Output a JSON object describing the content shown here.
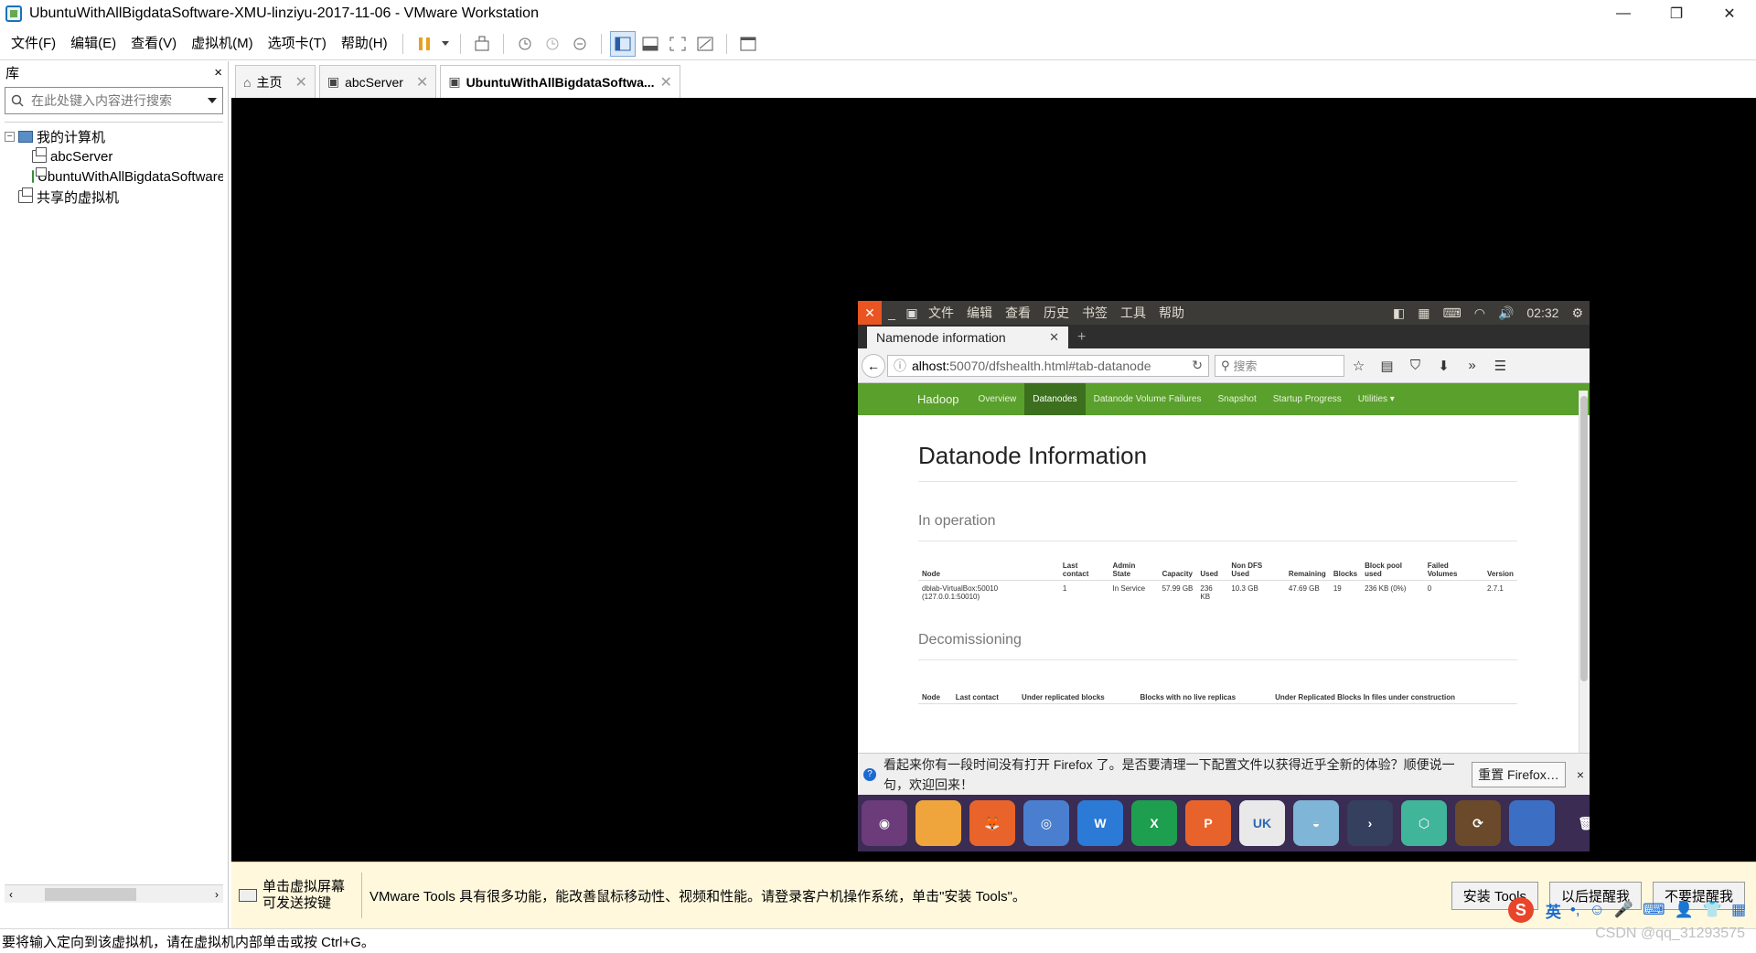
{
  "window": {
    "title": "UbuntuWithAllBigdataSoftware-XMU-linziyu-2017-11-06 - VMware Workstation",
    "minimize": "—",
    "maximize": "❐",
    "close": "✕"
  },
  "menu": [
    "文件(F)",
    "编辑(E)",
    "查看(V)",
    "虚拟机(M)",
    "选项卡(T)",
    "帮助(H)"
  ],
  "library": {
    "title": "库",
    "close": "×",
    "search_placeholder": "在此处键入内容进行搜索",
    "tree": {
      "root": "我的计算机",
      "vms": [
        "abcServer",
        "UbuntuWithAllBigdataSoftware"
      ],
      "shared": "共享的虚拟机"
    }
  },
  "tabs": [
    {
      "label": "主页",
      "icon": "home-icon"
    },
    {
      "label": "abcServer",
      "icon": "vm-icon"
    },
    {
      "label": "UbuntuWithAllBigdataSoftwa...",
      "icon": "vm-icon"
    }
  ],
  "guest": {
    "topbar": {
      "close": "✕",
      "menus": [
        "文件",
        "编辑",
        "查看",
        "历史",
        "书签",
        "工具",
        "帮助"
      ],
      "time": "02:32"
    },
    "firefox": {
      "tab_title": "Namenode information",
      "url_host": "alhost:",
      "url_path": "50070/dfshealth.html#tab-datanode",
      "search_placeholder": "搜索"
    },
    "hadoop_nav": {
      "brand": "Hadoop",
      "items": [
        "Overview",
        "Datanodes",
        "Datanode Volume Failures",
        "Snapshot",
        "Startup Progress",
        "Utilities ▾"
      ],
      "active": "Datanodes"
    },
    "page": {
      "title": "Datanode Information",
      "in_operation": "In operation",
      "op_headers": [
        "Node",
        "Last contact",
        "Admin State",
        "Capacity",
        "Used",
        "Non DFS Used",
        "Remaining",
        "Blocks",
        "Block pool used",
        "Failed Volumes",
        "Version"
      ],
      "op_rows": [
        [
          "dblab-VirtualBox:50010 (127.0.0.1:50010)",
          "1",
          "In Service",
          "57.99 GB",
          "236 KB",
          "10.3 GB",
          "47.69 GB",
          "19",
          "236 KB (0%)",
          "0",
          "2.7.1"
        ]
      ],
      "decommissioning": "Decomissioning",
      "dec_headers": [
        "Node",
        "Last contact",
        "Under replicated blocks",
        "Blocks with no live replicas",
        "Under Replicated Blocks In files under construction"
      ]
    },
    "notification": {
      "message": "看起来你有一段时间没有打开 Firefox 了。是否要清理一下配置文件以获得近乎全新的体验？顺便说一句，欢迎回来！",
      "button": "重置 Firefox…",
      "close": "×"
    },
    "dock": [
      {
        "name": "ubuntu-logo-icon",
        "color": "#6b3b7a",
        "label": "◉"
      },
      {
        "name": "files-icon",
        "color": "#f0a53c",
        "label": ""
      },
      {
        "name": "firefox-icon",
        "color": "#e8642a",
        "label": "🦊"
      },
      {
        "name": "chromium-icon",
        "color": "#4a7fd0",
        "label": "◎"
      },
      {
        "name": "wps-writer-icon",
        "color": "#2b7ad6",
        "label": "W"
      },
      {
        "name": "wps-spreadsheet-icon",
        "color": "#1e9e4f",
        "label": "X"
      },
      {
        "name": "wps-presentation-icon",
        "color": "#e8632b",
        "label": "P"
      },
      {
        "name": "uk-software-icon",
        "color": "#e9e9e9",
        "label": "UK"
      },
      {
        "name": "disk-icon",
        "color": "#7fb5d6",
        "label": "◒"
      },
      {
        "name": "terminal-icon",
        "color": "#34405e",
        "label": "›"
      },
      {
        "name": "package-icon",
        "color": "#41b59a",
        "label": "⬡"
      },
      {
        "name": "update-icon",
        "color": "#6a4a2a",
        "label": "⟳"
      },
      {
        "name": "workspace-icon",
        "color": "#3c6fc4",
        "label": ""
      },
      {
        "name": "trash-icon",
        "color": "#3a2c53",
        "label": "🗑"
      }
    ]
  },
  "infobar": {
    "hint": "单击虚拟屏幕可发送按键",
    "message": "VMware Tools 具有很多功能，能改善鼠标移动性、视频和性能。请登录客户机操作系统，单击\"安装 Tools\"。",
    "buttons": [
      "安装 Tools",
      "以后提醒我",
      "不要提醒我"
    ]
  },
  "statusbar": {
    "text": "要将输入定向到该虚拟机，请在虚拟机内部单击或按 Ctrl+G。"
  },
  "ime": {
    "lang": "英"
  },
  "watermark": "CSDN @qq_31293575"
}
